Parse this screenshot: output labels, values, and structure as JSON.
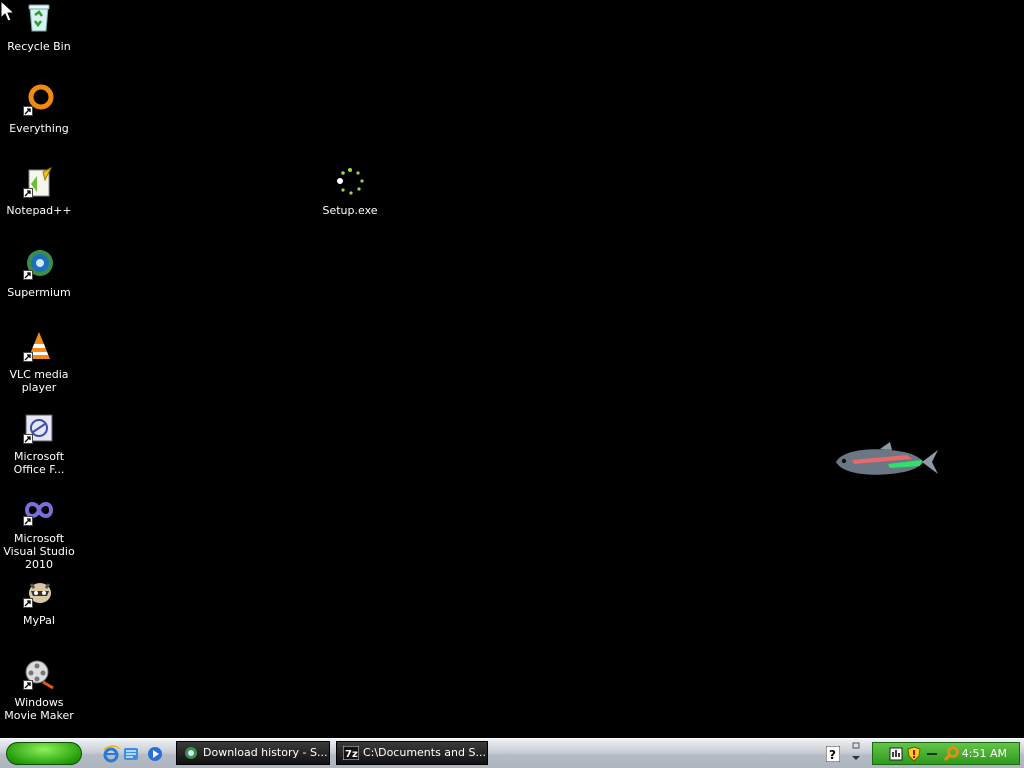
{
  "desktop": {
    "icons": [
      {
        "label": "Recycle Bin"
      },
      {
        "label": "Everything"
      },
      {
        "label": "Notepad++"
      },
      {
        "label": "Supermium"
      },
      {
        "label": "VLC media player"
      },
      {
        "label": "Microsoft Office F..."
      },
      {
        "label": "Microsoft Visual Studio 2010"
      },
      {
        "label": "MyPal"
      },
      {
        "label": "Windows Movie Maker"
      },
      {
        "label": "Setup.exe"
      }
    ]
  },
  "taskbar": {
    "buttons": [
      {
        "label": "Download history - S..."
      },
      {
        "label": "C:\\Documents and S..."
      }
    ],
    "clock": "4:51 AM",
    "quick_launch": [
      "ie-icon",
      "outlook-express-icon",
      "media-player-icon"
    ],
    "colors": {
      "start": "#2aa410",
      "tray": "#3fae2b",
      "button": "#1a1a1a"
    }
  }
}
